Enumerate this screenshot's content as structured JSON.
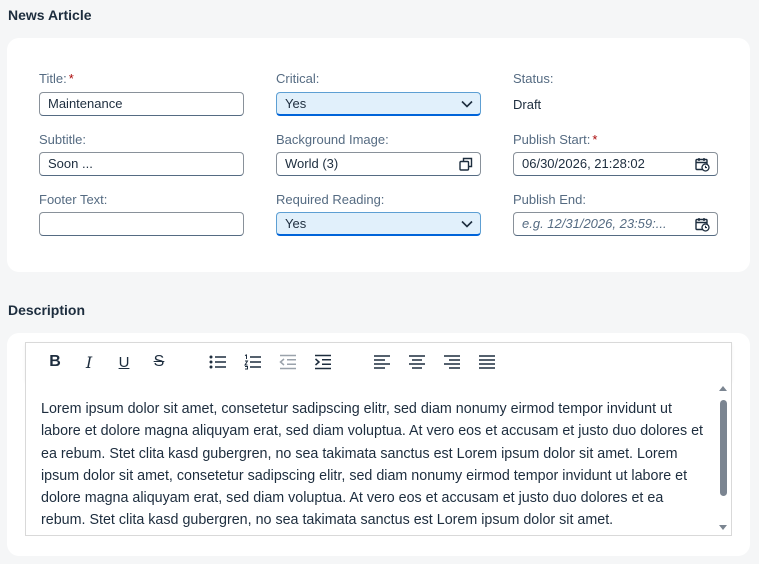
{
  "sections": {
    "article_title": "News Article",
    "description_title": "Description"
  },
  "form": {
    "title": {
      "label": "Title:",
      "required": "*",
      "value": "Maintenance"
    },
    "subtitle": {
      "label": "Subtitle:",
      "value": "Soon ..."
    },
    "footer": {
      "label": "Footer Text:",
      "value": ""
    },
    "critical": {
      "label": "Critical:",
      "value": "Yes"
    },
    "background_image": {
      "label": "Background Image:",
      "value": "World (3)"
    },
    "required_reading": {
      "label": "Required Reading:",
      "value": "Yes"
    },
    "status": {
      "label": "Status:",
      "value": "Draft"
    },
    "publish_start": {
      "label": "Publish Start:",
      "required": "*",
      "value": "06/30/2026, 21:28:02"
    },
    "publish_end": {
      "label": "Publish End:",
      "placeholder": "e.g. 12/31/2026, 23:59:..."
    }
  },
  "toolbar": {
    "bold": "B",
    "italic": "I",
    "underline": "U",
    "strikethrough": "S"
  },
  "editor": {
    "text": "Lorem ipsum dolor sit amet, consetetur sadipscing elitr, sed diam nonumy eirmod tempor invidunt ut labore et dolore magna aliquyam erat, sed diam voluptua. At vero eos et accusam et justo duo dolores et ea rebum. Stet clita kasd gubergren, no sea takimata sanctus est Lorem ipsum dolor sit amet. Lorem ipsum dolor sit amet, consetetur sadipscing elitr, sed diam nonumy eirmod tempor invidunt ut labore et dolore magna aliquyam erat, sed diam voluptua. At vero eos et accusam et justo duo dolores et ea rebum. Stet clita kasd gubergren, no sea takimata sanctus est Lorem ipsum dolor sit amet."
  },
  "colors": {
    "accent": "#0064d9",
    "select_bg": "#e1f0fb",
    "required": "#aa0808"
  },
  "icons": {
    "dropdown": "chevron-down-icon",
    "value_help": "value-help-icon",
    "calendar": "calendar-icon"
  }
}
